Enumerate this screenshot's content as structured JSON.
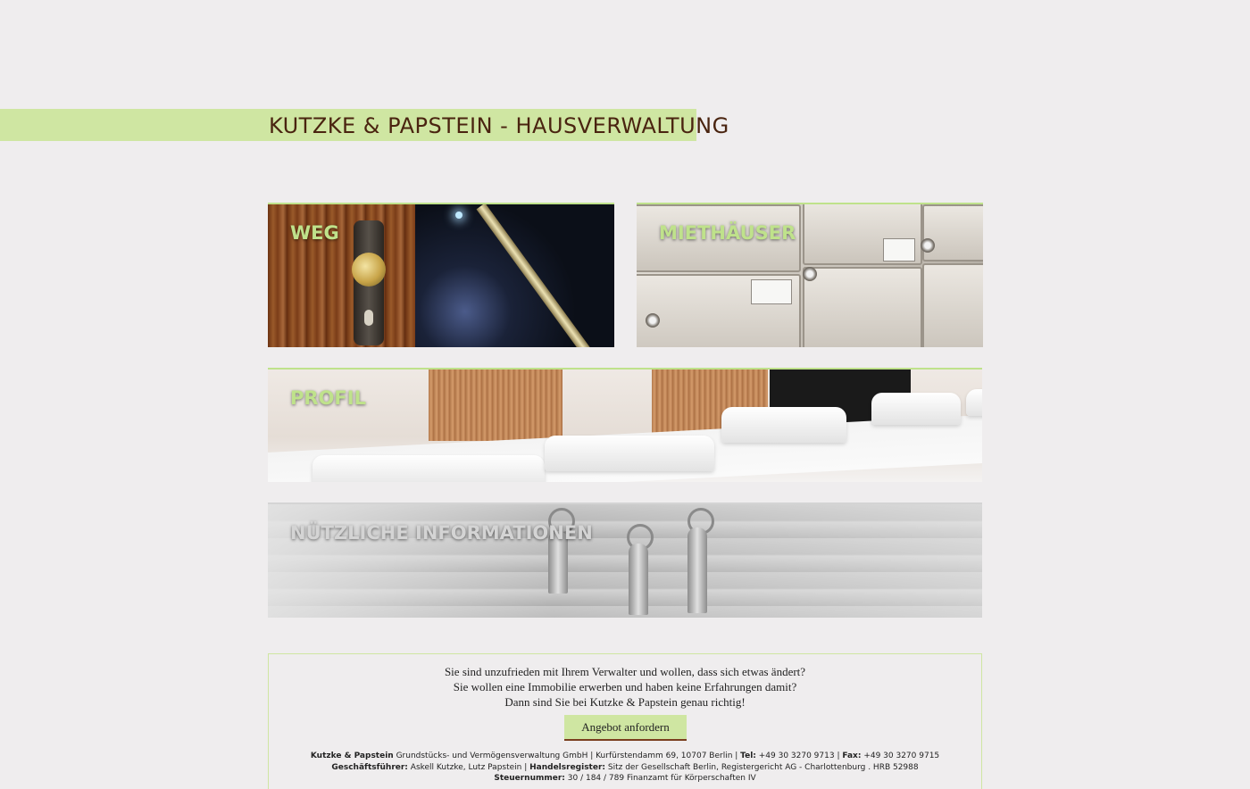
{
  "header": {
    "title": "KUTZKE & PAPSTEIN - HAUSVERWALTUNG",
    "accent_color": "#cfe6a2",
    "title_color": "#4a2410"
  },
  "tiles": [
    {
      "label": "WEG",
      "image": "door-knob-photo"
    },
    {
      "label": "MIETHÄUSER",
      "image": "mailboxes-photo"
    },
    {
      "label": "PROFIL",
      "image": "conference-chairs-photo"
    },
    {
      "label": "NÜTZLICHE INFORMATIONEN",
      "image": "keys-on-wall-photo"
    }
  ],
  "cta": {
    "line1": "Sie sind unzufrieden mit Ihrem Verwalter und wollen, dass sich etwas ändert?",
    "line2": "Sie wollen eine Immobilie erwerben und haben keine Erfahrungen damit?",
    "line3": "Dann sind Sie bei Kutzke & Papstein genau richtig!",
    "button_label": "Angebot anfordern"
  },
  "imprint": {
    "company_name": "Kutzke & Papstein",
    "company_rest": " Grundstücks- und Vermögensverwaltung GmbH | Kurfürstendamm 69, 10707 Berlin | ",
    "tel_label": "Tel:",
    "tel_value": " +49 30 3270 9713 | ",
    "fax_label": "Fax:",
    "fax_value": " +49 30 3270 9715",
    "gf_label": "Geschäftsführer:",
    "gf_value": " Askell Kutzke, Lutz Papstein | ",
    "hr_label": "Handelsregister:",
    "hr_value": " Sitz der Gesellschaft Berlin, Registergericht AG - Charlottenburg . HRB 52988",
    "tax_label": "Steuernummer:",
    "tax_value": " 30 / 184 / 789 Finanzamt für Körperschaften IV"
  }
}
